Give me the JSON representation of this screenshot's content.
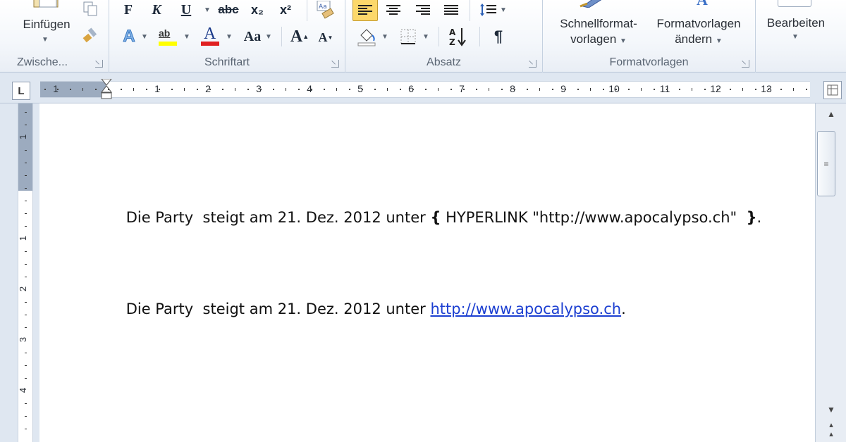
{
  "ribbon": {
    "clipboard": {
      "label": "Zwische...",
      "paste_label": "Einfügen"
    },
    "font": {
      "label": "Schriftart",
      "bold": "F",
      "italic": "K",
      "underline": "U",
      "strike": "abc",
      "subscript": "x₂",
      "superscript": "x²",
      "case": "Aa",
      "grow": "A",
      "shrink": "A",
      "highlight_text": "ab",
      "effects": "A",
      "color_letter": "A",
      "clear_format": "Aa"
    },
    "paragraph": {
      "label": "Absatz",
      "sort": "A↓Z",
      "pilcrow": "¶"
    },
    "styles": {
      "label": "Formatvorlagen",
      "quick_styles_line1": "Schnellformat-",
      "quick_styles_line2": "vorlagen",
      "change_styles_line1": "Formatvorlagen",
      "change_styles_line2": "ändern"
    },
    "editing": {
      "label": "Bearbeiten"
    }
  },
  "ruler": {
    "tab_stop": "L",
    "numbers": [
      "1",
      "1",
      "2",
      "3",
      "4",
      "5",
      "6",
      "7",
      "8",
      "9",
      "10",
      "11",
      "12",
      "13"
    ],
    "vertical_numbers": [
      "1",
      "1",
      "2",
      "3",
      "4"
    ]
  },
  "document": {
    "line1_text": "Die Party  steigt am 21. Dez. 2012 unter ",
    "line1_brace_open": "{",
    "line1_field": " HYPERLINK \"http://www.apocalypso.ch\"  ",
    "line1_brace_close": "}",
    "line1_end": ".",
    "line2_text": "Die Party  steigt am 21. Dez. 2012 unter ",
    "line2_link": "http://www.apocalypso.ch",
    "line2_end": "."
  },
  "colors": {
    "link": "#1c3fd1",
    "ruler_margin": "#9cabbf",
    "active_align": "#fcd86b"
  }
}
